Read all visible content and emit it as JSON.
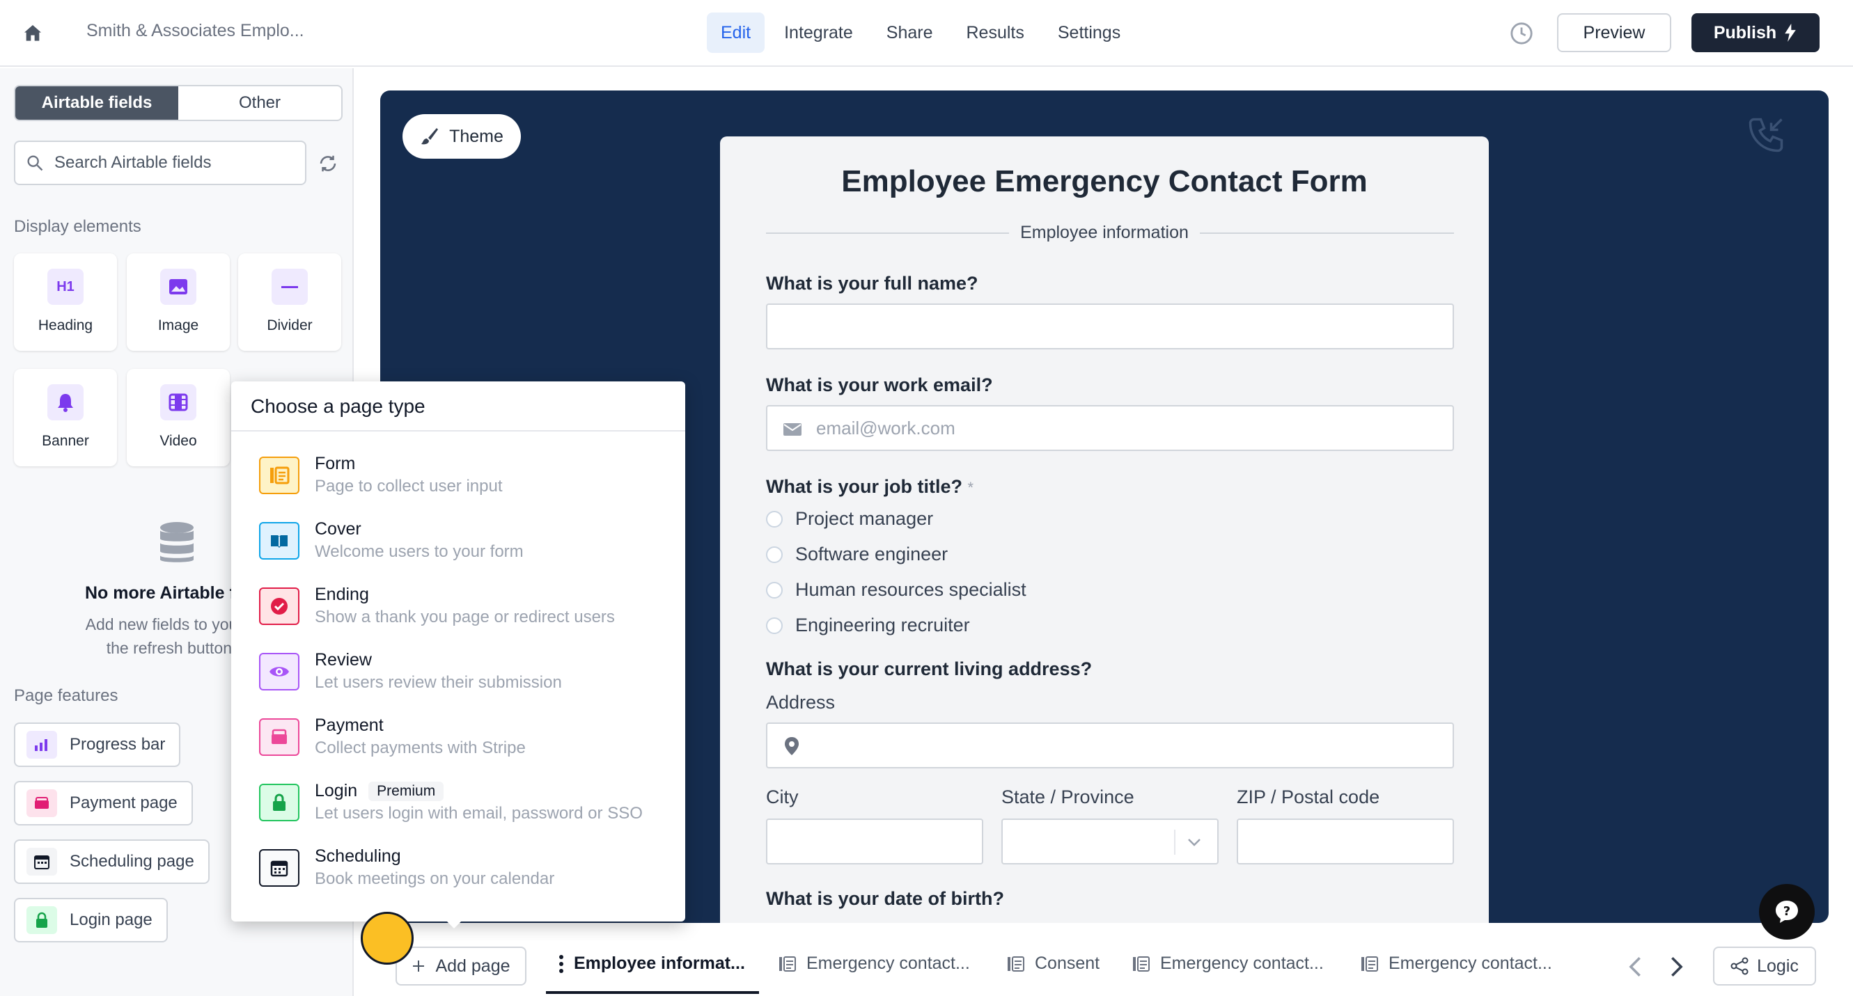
{
  "topbar": {
    "project_title": "Smith & Associates Emplo...",
    "tabs": [
      {
        "label": "Edit",
        "active": true
      },
      {
        "label": "Integrate",
        "active": false
      },
      {
        "label": "Share",
        "active": false
      },
      {
        "label": "Results",
        "active": false
      },
      {
        "label": "Settings",
        "active": false
      }
    ],
    "preview_label": "Preview",
    "publish_label": "Publish"
  },
  "sidebar": {
    "segments": [
      "Airtable fields",
      "Other"
    ],
    "search_placeholder": "Search Airtable fields",
    "display_elements_label": "Display elements",
    "elements": [
      "Heading",
      "Image",
      "Divider",
      "Banner",
      "Video"
    ],
    "empty_title": "No more Airtable fi",
    "empty_desc_1": "Add new fields to your tab",
    "empty_desc_2": "the refresh button in",
    "page_features_label": "Page features",
    "features": [
      "Progress bar",
      "Payment page",
      "Scheduling page",
      "Login page"
    ]
  },
  "canvas": {
    "theme_label": "Theme",
    "form": {
      "title": "Employee Emergency Contact Form",
      "section": "Employee information",
      "q_full_name": "What is your full name?",
      "q_work_email": "What is your work email?",
      "email_placeholder": "email@work.com",
      "q_job_title": "What is your job title?",
      "required_mark": "*",
      "job_options": [
        "Project manager",
        "Software engineer",
        "Human resources specialist",
        "Engineering recruiter"
      ],
      "q_address": "What is your current living address?",
      "address_label": "Address",
      "city_label": "City",
      "state_label": "State / Province",
      "zip_label": "ZIP / Postal code",
      "q_dob": "What is your date of birth?"
    }
  },
  "popup": {
    "title": "Choose a page type",
    "types": [
      {
        "name": "Form",
        "desc": "Page to collect user input"
      },
      {
        "name": "Cover",
        "desc": "Welcome users to your form"
      },
      {
        "name": "Ending",
        "desc": "Show a thank you page or redirect users"
      },
      {
        "name": "Review",
        "desc": "Let users review their submission"
      },
      {
        "name": "Payment",
        "desc": "Collect payments with Stripe"
      },
      {
        "name": "Login",
        "desc": "Let users login with email, password or SSO",
        "badge": "Premium"
      },
      {
        "name": "Scheduling",
        "desc": "Book meetings on your calendar"
      }
    ]
  },
  "bottombar": {
    "add_page_label": "Add page",
    "pages": [
      "Employee informat...",
      "Emergency contact...",
      "Consent",
      "Emergency contact...",
      "Emergency contact..."
    ],
    "logic_label": "Logic"
  },
  "colors": {
    "canvas_bg": "#152c4e",
    "accent": "#2563eb",
    "publish_bg": "#1c2536",
    "cursor": "#fbbf24"
  }
}
